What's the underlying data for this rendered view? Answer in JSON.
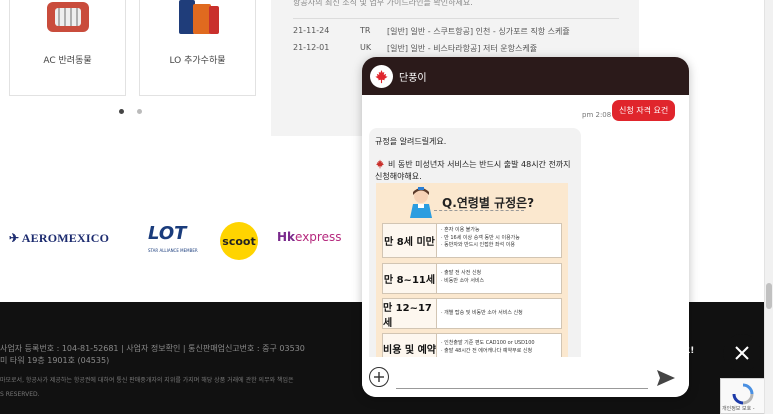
{
  "cards": [
    {
      "label": "AC 반려동물",
      "icon": "pet-carrier-icon"
    },
    {
      "label": "LO 추가수하물",
      "icon": "suitcase-icon"
    }
  ],
  "carousel": {
    "pages": 2,
    "active": 1
  },
  "notice": {
    "description": "항공사의 최신 소식 및 업무 가이드라인을 확인하세요.",
    "rows": [
      {
        "date": "21-11-24",
        "carrier": "TR",
        "title": "[일반] 일반 - 스쿠트항공] 인천 - 싱가포르 직항 스케쥴"
      },
      {
        "date": "21-12-01",
        "carrier": "UK",
        "title": "[일반] 일반 - 비스타라항공] 저터 운항스케쥴"
      }
    ]
  },
  "airline_logos": {
    "aeromexico": "AEROMEXICO",
    "lot": "LOT",
    "lot_sub": "STAR ALLIANCE MEMBER",
    "scoot": "scoot",
    "hk_prefix": "Hk",
    "hk_suffix": "express"
  },
  "footer": {
    "line1": "사업자 등록번호 : 104-81-52681  |  사업자 정보확인  |  통신판매업신고번호 : 중구 03530",
    "line2": "미 타워 19층 1901호 (04535)",
    "line3": "마모로서, 항공사가 제공하는 항공권에 대하여 통신 판매중개자의 지위를 가지며 해당 상품 거래에 관한 의무와 책임은",
    "line4": "S RESERVED."
  },
  "toast": "요!",
  "recaptcha": {
    "label": "개인정보 보호 -"
  },
  "chat": {
    "title": "단풍이",
    "user_message": "신청 자격 요건",
    "timestamp": "pm 2:08",
    "bot_line1": "규정을 알려드릴게요.",
    "bot_line2": "비 동반 미성년자 서비스는 반드시 출발 48시간 전까지 신청해야해요.",
    "card": {
      "title": "Q.연령별 규정은?",
      "rows": [
        {
          "key": "만 8세 미만",
          "values": [
            "· 혼자 이용 불가능",
            "· 만 16세 이상 승객 동반 시 이용가능",
            "· 동반자와 반드시 인접한 좌석 이용"
          ]
        },
        {
          "key": "만 8~11세",
          "values": [
            "· 출발 전 사전 신청",
            "· 비동반 소아 서비스"
          ]
        },
        {
          "key": "만 12~17세",
          "values": [
            "· 개별 탑승 및 비동반 소아 서비스 신청"
          ]
        },
        {
          "key": "비용 및 예약",
          "values": [
            "· 인천출발 기준 편도 CAD100 or USD100",
            "· 출발 48시간 전 에어캐나다 예약부로 신청"
          ]
        }
      ]
    },
    "input_placeholder": ""
  },
  "colors": {
    "accent": "#e0252c",
    "header": "#2b1a1a",
    "footer": "#111111",
    "card_bg": "#fbe8cf"
  }
}
